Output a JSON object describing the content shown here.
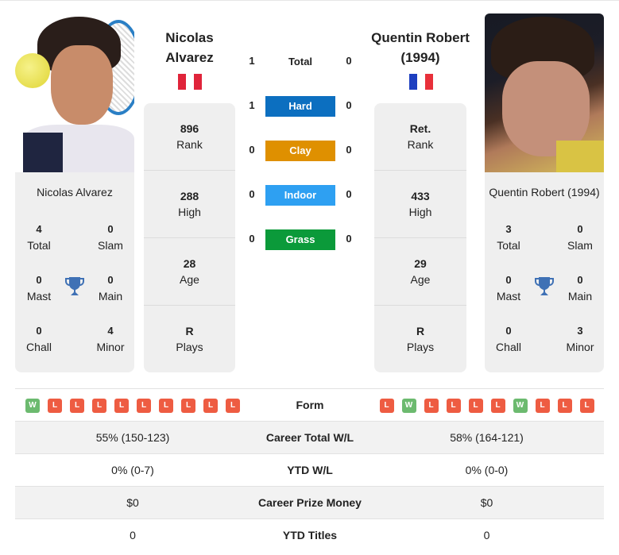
{
  "colors": {
    "hard": "#0c6fc0",
    "clay": "#df9000",
    "indoor": "#2ea0f2",
    "grass": "#0b9a3a",
    "win": "#6cba6f",
    "loss": "#ee5c42",
    "trophy": "#3f71b5",
    "peru_red": "#e0243a",
    "france_blue": "#1d3fc0",
    "france_red": "#e8303a"
  },
  "player1": {
    "name": "Nicolas Alvarez",
    "name_line1": "Nicolas",
    "name_line2": "Alvarez",
    "flag": "peru-flag",
    "photo": "player-photo",
    "titles": {
      "total": {
        "value": "4",
        "label": "Total"
      },
      "slam": {
        "value": "0",
        "label": "Slam"
      },
      "mast": {
        "value": "0",
        "label": "Mast"
      },
      "main": {
        "value": "0",
        "label": "Main"
      },
      "chall": {
        "value": "0",
        "label": "Chall"
      },
      "minor": {
        "value": "4",
        "label": "Minor"
      }
    },
    "info": [
      {
        "value": "896",
        "label": "Rank"
      },
      {
        "value": "288",
        "label": "High"
      },
      {
        "value": "28",
        "label": "Age"
      },
      {
        "value": "R",
        "label": "Plays"
      }
    ],
    "form": [
      "W",
      "L",
      "L",
      "L",
      "L",
      "L",
      "L",
      "L",
      "L",
      "L"
    ]
  },
  "player2": {
    "name": "Quentin Robert (1994)",
    "name_line1": "Quentin Robert",
    "name_line2": "(1994)",
    "flag": "france-flag",
    "photo": "player-photo",
    "titles": {
      "total": {
        "value": "3",
        "label": "Total"
      },
      "slam": {
        "value": "0",
        "label": "Slam"
      },
      "mast": {
        "value": "0",
        "label": "Mast"
      },
      "main": {
        "value": "0",
        "label": "Main"
      },
      "chall": {
        "value": "0",
        "label": "Chall"
      },
      "minor": {
        "value": "3",
        "label": "Minor"
      }
    },
    "info": [
      {
        "value": "Ret.",
        "label": "Rank"
      },
      {
        "value": "433",
        "label": "High"
      },
      {
        "value": "29",
        "label": "Age"
      },
      {
        "value": "R",
        "label": "Plays"
      }
    ],
    "form": [
      "L",
      "W",
      "L",
      "L",
      "L",
      "L",
      "W",
      "L",
      "L",
      "L"
    ]
  },
  "h2h": [
    {
      "label": "Total",
      "p1": "1",
      "p2": "0"
    },
    {
      "label": "Hard",
      "p1": "1",
      "p2": "0"
    },
    {
      "label": "Clay",
      "p1": "0",
      "p2": "0"
    },
    {
      "label": "Indoor",
      "p1": "0",
      "p2": "0"
    },
    {
      "label": "Grass",
      "p1": "0",
      "p2": "0"
    }
  ],
  "table": {
    "form_label": "Form",
    "rows": [
      {
        "label": "Career Total W/L",
        "p1": "55% (150-123)",
        "p2": "58% (164-121)"
      },
      {
        "label": "YTD W/L",
        "p1": "0% (0-7)",
        "p2": "0% (0-0)"
      },
      {
        "label": "Career Prize Money",
        "p1": "$0",
        "p2": "$0"
      },
      {
        "label": "YTD Titles",
        "p1": "0",
        "p2": "0"
      }
    ]
  }
}
